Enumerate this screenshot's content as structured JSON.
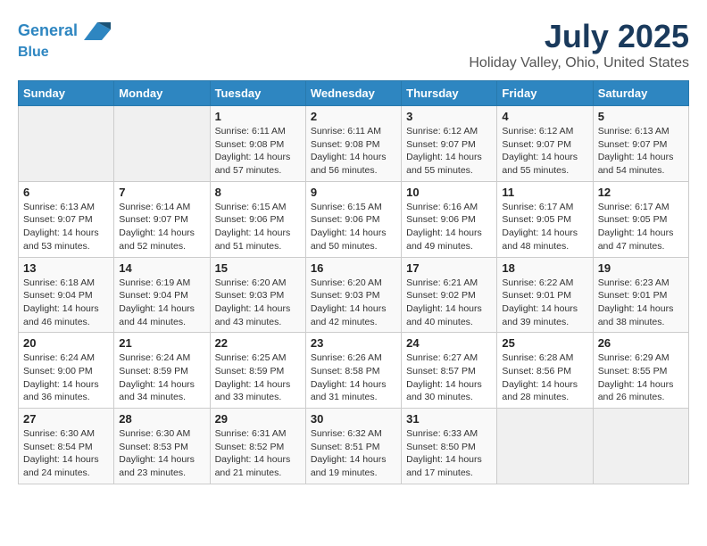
{
  "header": {
    "logo_line1": "General",
    "logo_line2": "Blue",
    "month_title": "July 2025",
    "location": "Holiday Valley, Ohio, United States"
  },
  "weekdays": [
    "Sunday",
    "Monday",
    "Tuesday",
    "Wednesday",
    "Thursday",
    "Friday",
    "Saturday"
  ],
  "weeks": [
    [
      {
        "day": "",
        "sunrise": "",
        "sunset": "",
        "daylight": ""
      },
      {
        "day": "",
        "sunrise": "",
        "sunset": "",
        "daylight": ""
      },
      {
        "day": "1",
        "sunrise": "Sunrise: 6:11 AM",
        "sunset": "Sunset: 9:08 PM",
        "daylight": "Daylight: 14 hours and 57 minutes."
      },
      {
        "day": "2",
        "sunrise": "Sunrise: 6:11 AM",
        "sunset": "Sunset: 9:08 PM",
        "daylight": "Daylight: 14 hours and 56 minutes."
      },
      {
        "day": "3",
        "sunrise": "Sunrise: 6:12 AM",
        "sunset": "Sunset: 9:07 PM",
        "daylight": "Daylight: 14 hours and 55 minutes."
      },
      {
        "day": "4",
        "sunrise": "Sunrise: 6:12 AM",
        "sunset": "Sunset: 9:07 PM",
        "daylight": "Daylight: 14 hours and 55 minutes."
      },
      {
        "day": "5",
        "sunrise": "Sunrise: 6:13 AM",
        "sunset": "Sunset: 9:07 PM",
        "daylight": "Daylight: 14 hours and 54 minutes."
      }
    ],
    [
      {
        "day": "6",
        "sunrise": "Sunrise: 6:13 AM",
        "sunset": "Sunset: 9:07 PM",
        "daylight": "Daylight: 14 hours and 53 minutes."
      },
      {
        "day": "7",
        "sunrise": "Sunrise: 6:14 AM",
        "sunset": "Sunset: 9:07 PM",
        "daylight": "Daylight: 14 hours and 52 minutes."
      },
      {
        "day": "8",
        "sunrise": "Sunrise: 6:15 AM",
        "sunset": "Sunset: 9:06 PM",
        "daylight": "Daylight: 14 hours and 51 minutes."
      },
      {
        "day": "9",
        "sunrise": "Sunrise: 6:15 AM",
        "sunset": "Sunset: 9:06 PM",
        "daylight": "Daylight: 14 hours and 50 minutes."
      },
      {
        "day": "10",
        "sunrise": "Sunrise: 6:16 AM",
        "sunset": "Sunset: 9:06 PM",
        "daylight": "Daylight: 14 hours and 49 minutes."
      },
      {
        "day": "11",
        "sunrise": "Sunrise: 6:17 AM",
        "sunset": "Sunset: 9:05 PM",
        "daylight": "Daylight: 14 hours and 48 minutes."
      },
      {
        "day": "12",
        "sunrise": "Sunrise: 6:17 AM",
        "sunset": "Sunset: 9:05 PM",
        "daylight": "Daylight: 14 hours and 47 minutes."
      }
    ],
    [
      {
        "day": "13",
        "sunrise": "Sunrise: 6:18 AM",
        "sunset": "Sunset: 9:04 PM",
        "daylight": "Daylight: 14 hours and 46 minutes."
      },
      {
        "day": "14",
        "sunrise": "Sunrise: 6:19 AM",
        "sunset": "Sunset: 9:04 PM",
        "daylight": "Daylight: 14 hours and 44 minutes."
      },
      {
        "day": "15",
        "sunrise": "Sunrise: 6:20 AM",
        "sunset": "Sunset: 9:03 PM",
        "daylight": "Daylight: 14 hours and 43 minutes."
      },
      {
        "day": "16",
        "sunrise": "Sunrise: 6:20 AM",
        "sunset": "Sunset: 9:03 PM",
        "daylight": "Daylight: 14 hours and 42 minutes."
      },
      {
        "day": "17",
        "sunrise": "Sunrise: 6:21 AM",
        "sunset": "Sunset: 9:02 PM",
        "daylight": "Daylight: 14 hours and 40 minutes."
      },
      {
        "day": "18",
        "sunrise": "Sunrise: 6:22 AM",
        "sunset": "Sunset: 9:01 PM",
        "daylight": "Daylight: 14 hours and 39 minutes."
      },
      {
        "day": "19",
        "sunrise": "Sunrise: 6:23 AM",
        "sunset": "Sunset: 9:01 PM",
        "daylight": "Daylight: 14 hours and 38 minutes."
      }
    ],
    [
      {
        "day": "20",
        "sunrise": "Sunrise: 6:24 AM",
        "sunset": "Sunset: 9:00 PM",
        "daylight": "Daylight: 14 hours and 36 minutes."
      },
      {
        "day": "21",
        "sunrise": "Sunrise: 6:24 AM",
        "sunset": "Sunset: 8:59 PM",
        "daylight": "Daylight: 14 hours and 34 minutes."
      },
      {
        "day": "22",
        "sunrise": "Sunrise: 6:25 AM",
        "sunset": "Sunset: 8:59 PM",
        "daylight": "Daylight: 14 hours and 33 minutes."
      },
      {
        "day": "23",
        "sunrise": "Sunrise: 6:26 AM",
        "sunset": "Sunset: 8:58 PM",
        "daylight": "Daylight: 14 hours and 31 minutes."
      },
      {
        "day": "24",
        "sunrise": "Sunrise: 6:27 AM",
        "sunset": "Sunset: 8:57 PM",
        "daylight": "Daylight: 14 hours and 30 minutes."
      },
      {
        "day": "25",
        "sunrise": "Sunrise: 6:28 AM",
        "sunset": "Sunset: 8:56 PM",
        "daylight": "Daylight: 14 hours and 28 minutes."
      },
      {
        "day": "26",
        "sunrise": "Sunrise: 6:29 AM",
        "sunset": "Sunset: 8:55 PM",
        "daylight": "Daylight: 14 hours and 26 minutes."
      }
    ],
    [
      {
        "day": "27",
        "sunrise": "Sunrise: 6:30 AM",
        "sunset": "Sunset: 8:54 PM",
        "daylight": "Daylight: 14 hours and 24 minutes."
      },
      {
        "day": "28",
        "sunrise": "Sunrise: 6:30 AM",
        "sunset": "Sunset: 8:53 PM",
        "daylight": "Daylight: 14 hours and 23 minutes."
      },
      {
        "day": "29",
        "sunrise": "Sunrise: 6:31 AM",
        "sunset": "Sunset: 8:52 PM",
        "daylight": "Daylight: 14 hours and 21 minutes."
      },
      {
        "day": "30",
        "sunrise": "Sunrise: 6:32 AM",
        "sunset": "Sunset: 8:51 PM",
        "daylight": "Daylight: 14 hours and 19 minutes."
      },
      {
        "day": "31",
        "sunrise": "Sunrise: 6:33 AM",
        "sunset": "Sunset: 8:50 PM",
        "daylight": "Daylight: 14 hours and 17 minutes."
      },
      {
        "day": "",
        "sunrise": "",
        "sunset": "",
        "daylight": ""
      },
      {
        "day": "",
        "sunrise": "",
        "sunset": "",
        "daylight": ""
      }
    ]
  ]
}
